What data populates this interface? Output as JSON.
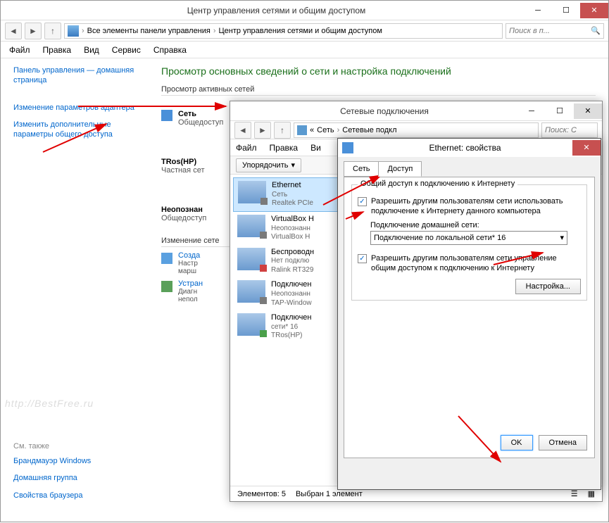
{
  "mainWindow": {
    "title": "Центр управления сетями и общим доступом",
    "nav": {
      "back": "←",
      "forward": "→",
      "up": "↑"
    },
    "breadcrumb": {
      "root_icon": "control-panel-icon",
      "item1": "Все элементы панели управления",
      "item2": "Центр управления сетями и общим доступом"
    },
    "search_placeholder": "Поиск в п...",
    "menu": {
      "file": "Файл",
      "edit": "Правка",
      "view": "Вид",
      "tools": "Сервис",
      "help": "Справка"
    },
    "sidebar": {
      "home": "Панель управления — домашняя страница",
      "adapter": "Изменение параметров адаптера",
      "sharing": "Изменить дополнительные параметры общего доступа",
      "seealso_hdr": "См. также",
      "firewall": "Брандмауэр Windows",
      "homegroup": "Домашняя группа",
      "inetopts": "Свойства браузера"
    },
    "main": {
      "heading": "Просмотр основных сведений о сети и настройка подключений",
      "active_hdr": "Просмотр активных сетей",
      "net1_name": "Сеть",
      "net1_sub": "Общедоступ",
      "net2_name": "TRos(HP)",
      "net2_sub": "Частная сет",
      "net3_name": "Неопознан",
      "net3_sub": "Общедоступ",
      "change_hdr": "Изменение сете",
      "create_title": "Созда",
      "create_sub1": "Настр",
      "create_sub2": "марш",
      "diag_title": "Устран",
      "diag_sub1": "Диагн",
      "diag_sub2": "непол"
    }
  },
  "connWindow": {
    "title": "Сетевые подключения",
    "breadcrumb": {
      "prefix": "«",
      "item1": "Сеть",
      "item2": "Сетевые подкл"
    },
    "search_placeholder": "Поиск: С",
    "menu": {
      "file": "Файл",
      "edit": "Правка",
      "view": "Ви"
    },
    "organize": "Упорядочить",
    "conns": [
      {
        "name": "Ethernet",
        "sub1": "Сеть",
        "sub2": "Realtek PCIe"
      },
      {
        "name": "VirtualBox H",
        "sub1": "Неопознанн",
        "sub2": "VirtualBox H"
      },
      {
        "name": "Беспроводн",
        "sub1": "Нет подклю",
        "sub2": "Ralink RT329"
      },
      {
        "name": "Подключен",
        "sub1": "Неопознанн",
        "sub2": "TAP-Window"
      },
      {
        "name": "Подключен",
        "sub1": "сети* 16",
        "sub2": "TRos(HP)"
      }
    ],
    "status": {
      "count_label": "Элементов: 5",
      "sel_label": "Выбран 1 элемент"
    }
  },
  "propsWindow": {
    "title": "Ethernet: свойства",
    "tabs": {
      "net": "Сеть",
      "access": "Доступ"
    },
    "group_legend": "Общий доступ к подключению к Интернету",
    "chk1": "Разрешить другим пользователям сети использовать подключение к Интернету данного компьютера",
    "home_label": "Подключение домашней сети:",
    "home_value": "Подключение по локальной сети* 16",
    "chk2": "Разрешить другим пользователям сети управление общим доступом к подключению к Интернету",
    "settings_btn": "Настройка...",
    "ok": "OK",
    "cancel": "Отмена"
  },
  "watermark": "http://BestFree.ru"
}
